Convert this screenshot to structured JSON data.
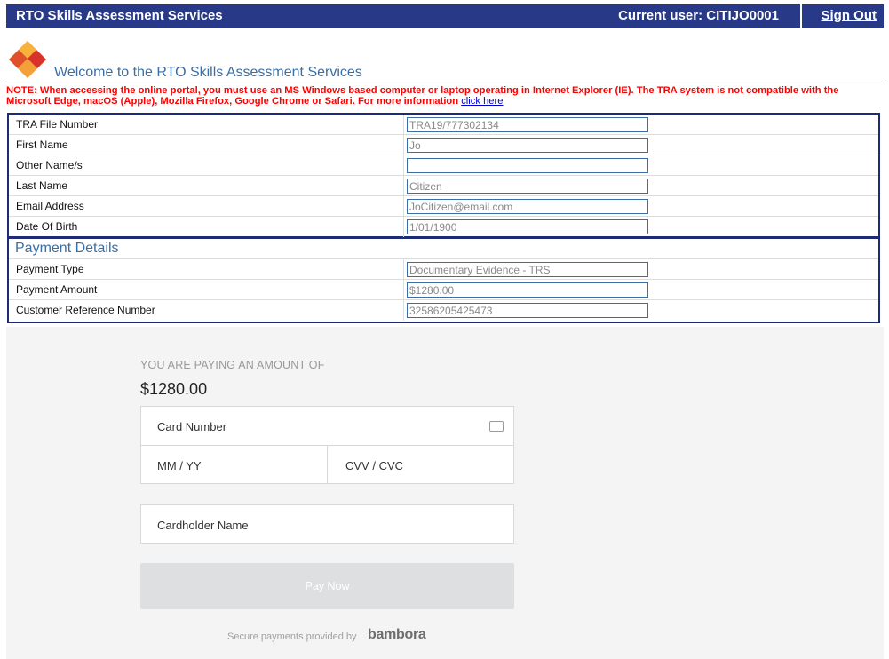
{
  "header": {
    "title": "RTO Skills Assessment Services",
    "current_user": "Current user: CITIJO0001",
    "sign_out": "Sign Out"
  },
  "welcome": "Welcome to the RTO Skills Assessment Services",
  "note": {
    "text": "NOTE: When accessing the online portal, you must use an MS Windows based computer or laptop operating in Internet Explorer (IE). The TRA system is not compatible with the Microsoft Edge, macOS (Apple), Mozilla Firefox, Google Chrome or Safari. For more information",
    "link": "click here"
  },
  "applicant": [
    {
      "label": "TRA File Number",
      "value": "TRA19/777302134"
    },
    {
      "label": "First Name",
      "value": "Jo"
    },
    {
      "label": "Other Name/s",
      "value": ""
    },
    {
      "label": "Last Name",
      "value": "Citizen"
    },
    {
      "label": "Email Address",
      "value": "JoCitizen@email.com"
    },
    {
      "label": "Date Of Birth",
      "value": "1/01/1900"
    }
  ],
  "payment_details": {
    "heading": "Payment Details",
    "rows": [
      {
        "label": "Payment Type",
        "value": "Documentary Evidence - TRS"
      },
      {
        "label": "Payment Amount",
        "value": "$1280.00"
      },
      {
        "label": "Customer Reference Number",
        "value": "32586205425473"
      }
    ]
  },
  "checkout": {
    "paying_label": "YOU ARE PAYING AN AMOUNT OF",
    "amount": "$1280.00",
    "card_number_placeholder": "Card Number",
    "expiry_placeholder": "MM / YY",
    "cvv_placeholder": "CVV / CVC",
    "cardholder_placeholder": "Cardholder Name",
    "pay_button": "Pay Now",
    "secure_text": "Secure payments provided by",
    "brand": "bambora",
    "card_icon": "credit-card-icon"
  },
  "colors": {
    "header_bg": "#283a87",
    "note_text": "#ff0000",
    "accent": "#3a6ea5",
    "checkout_bg": "#f4f4f5"
  }
}
